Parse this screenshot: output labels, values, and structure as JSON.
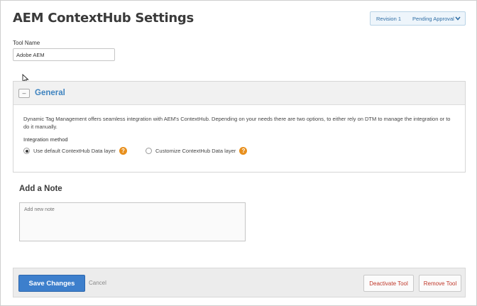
{
  "page": {
    "title": "AEM ContextHub Settings"
  },
  "status": {
    "revision": "Revision 1",
    "state": "Pending Approval",
    "chevron_icon": "chevron-down-icon"
  },
  "tool_name": {
    "label": "Tool Name",
    "value": "Adobe AEM"
  },
  "general": {
    "title": "General",
    "collapse_symbol": "–",
    "description": "Dynamic Tag Management offers seamless integration with AEM's ContextHub. Depending on your needs there are two options, to either rely on DTM to manage the integration or to do it manually.",
    "integration_label": "Integration method",
    "options": [
      {
        "label": "Use default ContextHub Data layer",
        "checked": true
      },
      {
        "label": "Customize ContextHub Data layer",
        "checked": false
      }
    ],
    "help_symbol": "?"
  },
  "note": {
    "title": "Add a Note",
    "placeholder": "Add new note"
  },
  "footer": {
    "save_label": "Save Changes",
    "cancel_label": "Cancel",
    "deactivate_label": "Deactivate Tool",
    "remove_label": "Remove Tool"
  },
  "colors": {
    "accent": "#3d7fcc",
    "danger": "#c0392b",
    "help": "#e8901e",
    "link": "#3f84c0"
  }
}
